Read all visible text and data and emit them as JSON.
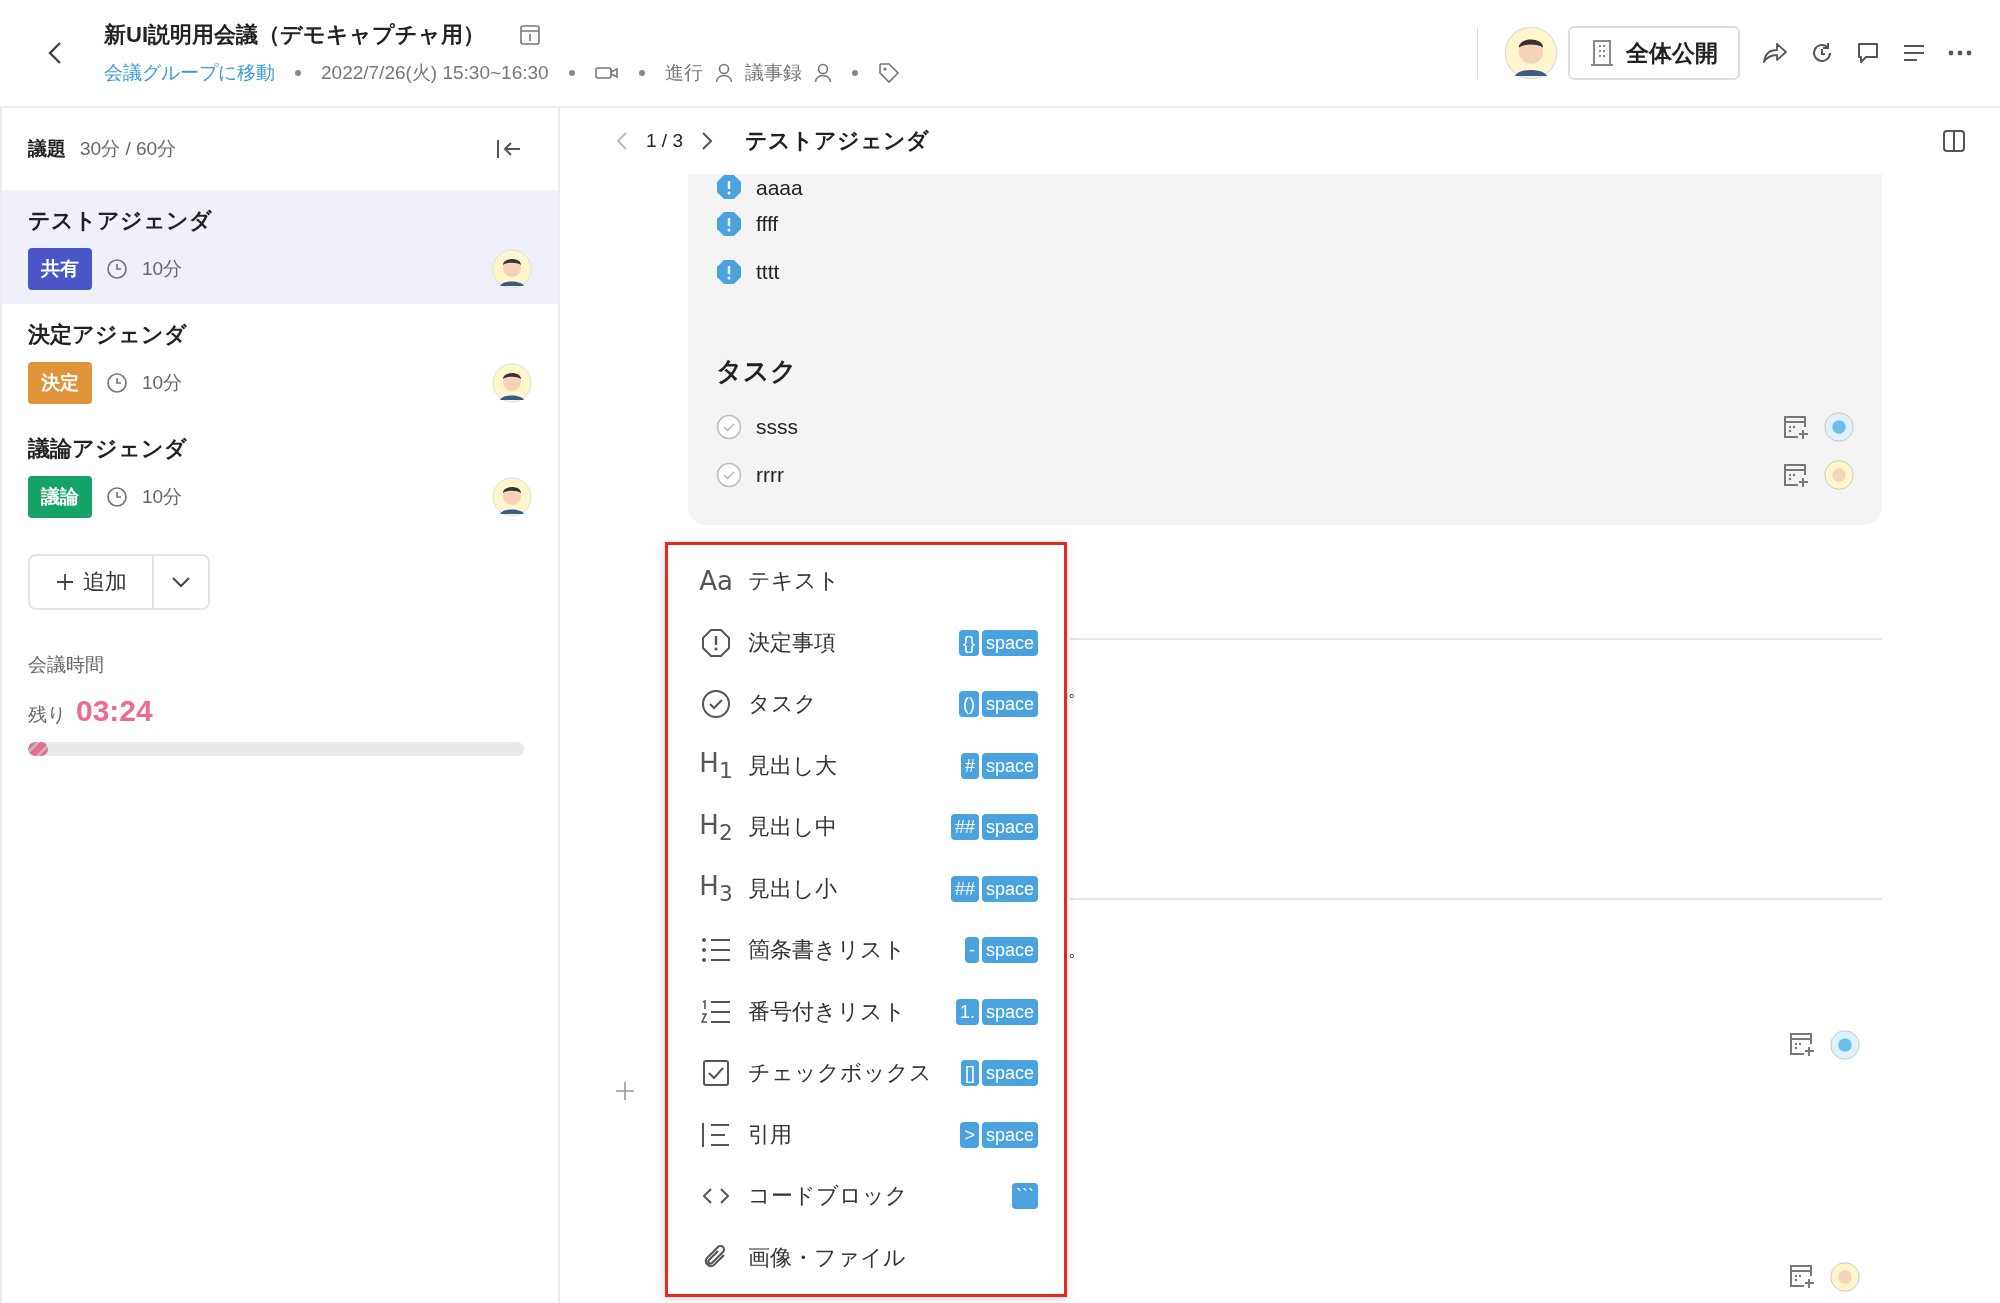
{
  "header": {
    "title": "新UI説明用会議（デモキャプチャ用）",
    "group_link": "会議グループに移動",
    "datetime": "2022/7/26(火) 15:30~16:30",
    "facilitator_label": "進行",
    "minutes_label": "議事録",
    "visibility_button": "全体公開"
  },
  "sidebar": {
    "heading": "議題",
    "time_summary": "30分 / 60分",
    "agendas": [
      {
        "name": "テストアジェンダ",
        "tag": "共有",
        "color": "#4a56c8",
        "duration": "10分",
        "selected": true
      },
      {
        "name": "決定アジェンダ",
        "tag": "決定",
        "color": "#e0943a",
        "duration": "10分",
        "selected": false
      },
      {
        "name": "議論アジェンダ",
        "tag": "議論",
        "color": "#15a36a",
        "duration": "10分",
        "selected": false
      }
    ],
    "add_button": "追加",
    "meeting_time_label": "会議時間",
    "remaining_label": "残り",
    "remaining_time": "03:24",
    "progress": {
      "level": 0.04
    }
  },
  "content": {
    "page": "1 / 3",
    "agenda_title": "テストアジェンダ",
    "decisions": [
      "aaaa",
      "ffff",
      "tttt"
    ],
    "tasks_heading": "タスク",
    "tasks": [
      "ssss",
      "rrrr"
    ],
    "hidden_fragments": [
      "。",
      "。"
    ]
  },
  "menu": {
    "items": [
      {
        "kind": "text",
        "glyph": "Aa",
        "label": "テキスト"
      },
      {
        "kind": "decision",
        "label": "決定事項",
        "shortcut": [
          "{}",
          "space"
        ]
      },
      {
        "kind": "task",
        "label": "タスク",
        "shortcut": [
          "()",
          "space"
        ]
      },
      {
        "kind": "heading",
        "glyph": "H$_{1}$",
        "label": "見出し大",
        "shortcut": [
          "#",
          "space"
        ]
      },
      {
        "kind": "heading",
        "glyph": "H$_{2}$",
        "label": "見出し中",
        "shortcut": [
          "##",
          "space"
        ]
      },
      {
        "kind": "heading",
        "glyph": "H$_{3}$",
        "label": "見出し小",
        "shortcut": [
          "##",
          "space"
        ]
      },
      {
        "kind": "bullet",
        "label": "箇条書きリスト",
        "shortcut": [
          "-",
          "space"
        ]
      },
      {
        "kind": "numbered",
        "label": "番号付きリスト",
        "shortcut": [
          "1.",
          "space"
        ]
      },
      {
        "kind": "checkbox",
        "label": "チェックボックス",
        "shortcut": [
          "[]",
          "space"
        ]
      },
      {
        "kind": "quote",
        "label": "引用",
        "shortcut": [
          ">",
          "space"
        ]
      },
      {
        "kind": "code",
        "label": "コードブロック",
        "shortcut": [
          "```"
        ]
      },
      {
        "kind": "file",
        "label": "画像・ファイル"
      }
    ]
  }
}
